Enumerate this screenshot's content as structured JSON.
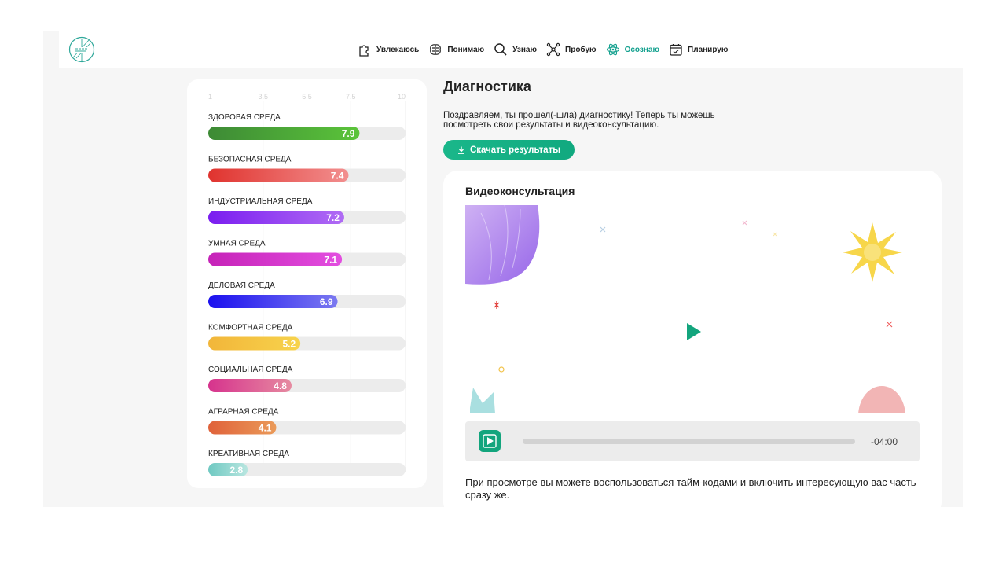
{
  "nav": {
    "items": [
      {
        "label": "Увлекаюсь",
        "icon": "puzzle-icon"
      },
      {
        "label": "Понимаю",
        "icon": "brain-icon"
      },
      {
        "label": "Узнаю",
        "icon": "search-icon"
      },
      {
        "label": "Пробую",
        "icon": "network-icon"
      },
      {
        "label": "Осознаю",
        "icon": "atom-icon",
        "active": true
      },
      {
        "label": "Планирую",
        "icon": "calendar-icon"
      }
    ]
  },
  "colors": {
    "accent": "#12a08e",
    "button": "#15b184",
    "page_bg": "#f6f6f6"
  },
  "chart_data": {
    "type": "bar",
    "orientation": "horizontal",
    "ticks": [
      1,
      3.5,
      5.5,
      7.5,
      10
    ],
    "xlim": [
      1,
      10
    ],
    "categories": [
      "ЗДОРОВАЯ СРЕДА",
      "БЕЗОПАСНАЯ СРЕДА",
      "ИНДУСТРИАЛЬНАЯ СРЕДА",
      "УМНАЯ СРЕДА",
      "ДЕЛОВАЯ СРЕДА",
      "КОМФОРТНАЯ СРЕДА",
      "СОЦИАЛЬНАЯ СРЕДА",
      "АГРАРНАЯ СРЕДА",
      "КРЕАТИВНАЯ СРЕДА"
    ],
    "values": [
      7.9,
      7.4,
      7.2,
      7.1,
      6.9,
      5.2,
      4.8,
      4.1,
      2.8
    ],
    "value_labels": [
      "7.9",
      "7.4",
      "7.2",
      "7.1",
      "6.9",
      "5.2",
      "4.8",
      "4.1",
      "2.8"
    ],
    "colors": [
      [
        "#3d8a35",
        "#5bc43a"
      ],
      [
        "#e0332e",
        "#f28f8f"
      ],
      [
        "#7a1df0",
        "#b06cf4"
      ],
      [
        "#c623b8",
        "#e34ee0"
      ],
      [
        "#1b10ef",
        "#7b79f0"
      ],
      [
        "#f2b63a",
        "#f7d34c"
      ],
      [
        "#d6338d",
        "#e68aa0"
      ],
      [
        "#e0623a",
        "#ea9a59"
      ],
      [
        "#6fc9c2",
        "#b9e6e0"
      ]
    ]
  },
  "main": {
    "title": "Диагностика",
    "description": "Поздравляем, ты прошел(-шла) диагностику! Теперь ты можешь посмотреть свои результаты и видеоконсультацию.",
    "download_label": "Скачать результаты"
  },
  "video": {
    "title": "Видеоконсультация",
    "time": "-04:00",
    "progress": 0,
    "note": "При просмотре вы можете воспользоваться тайм-кодами и включить интересующую вас часть сразу же."
  }
}
